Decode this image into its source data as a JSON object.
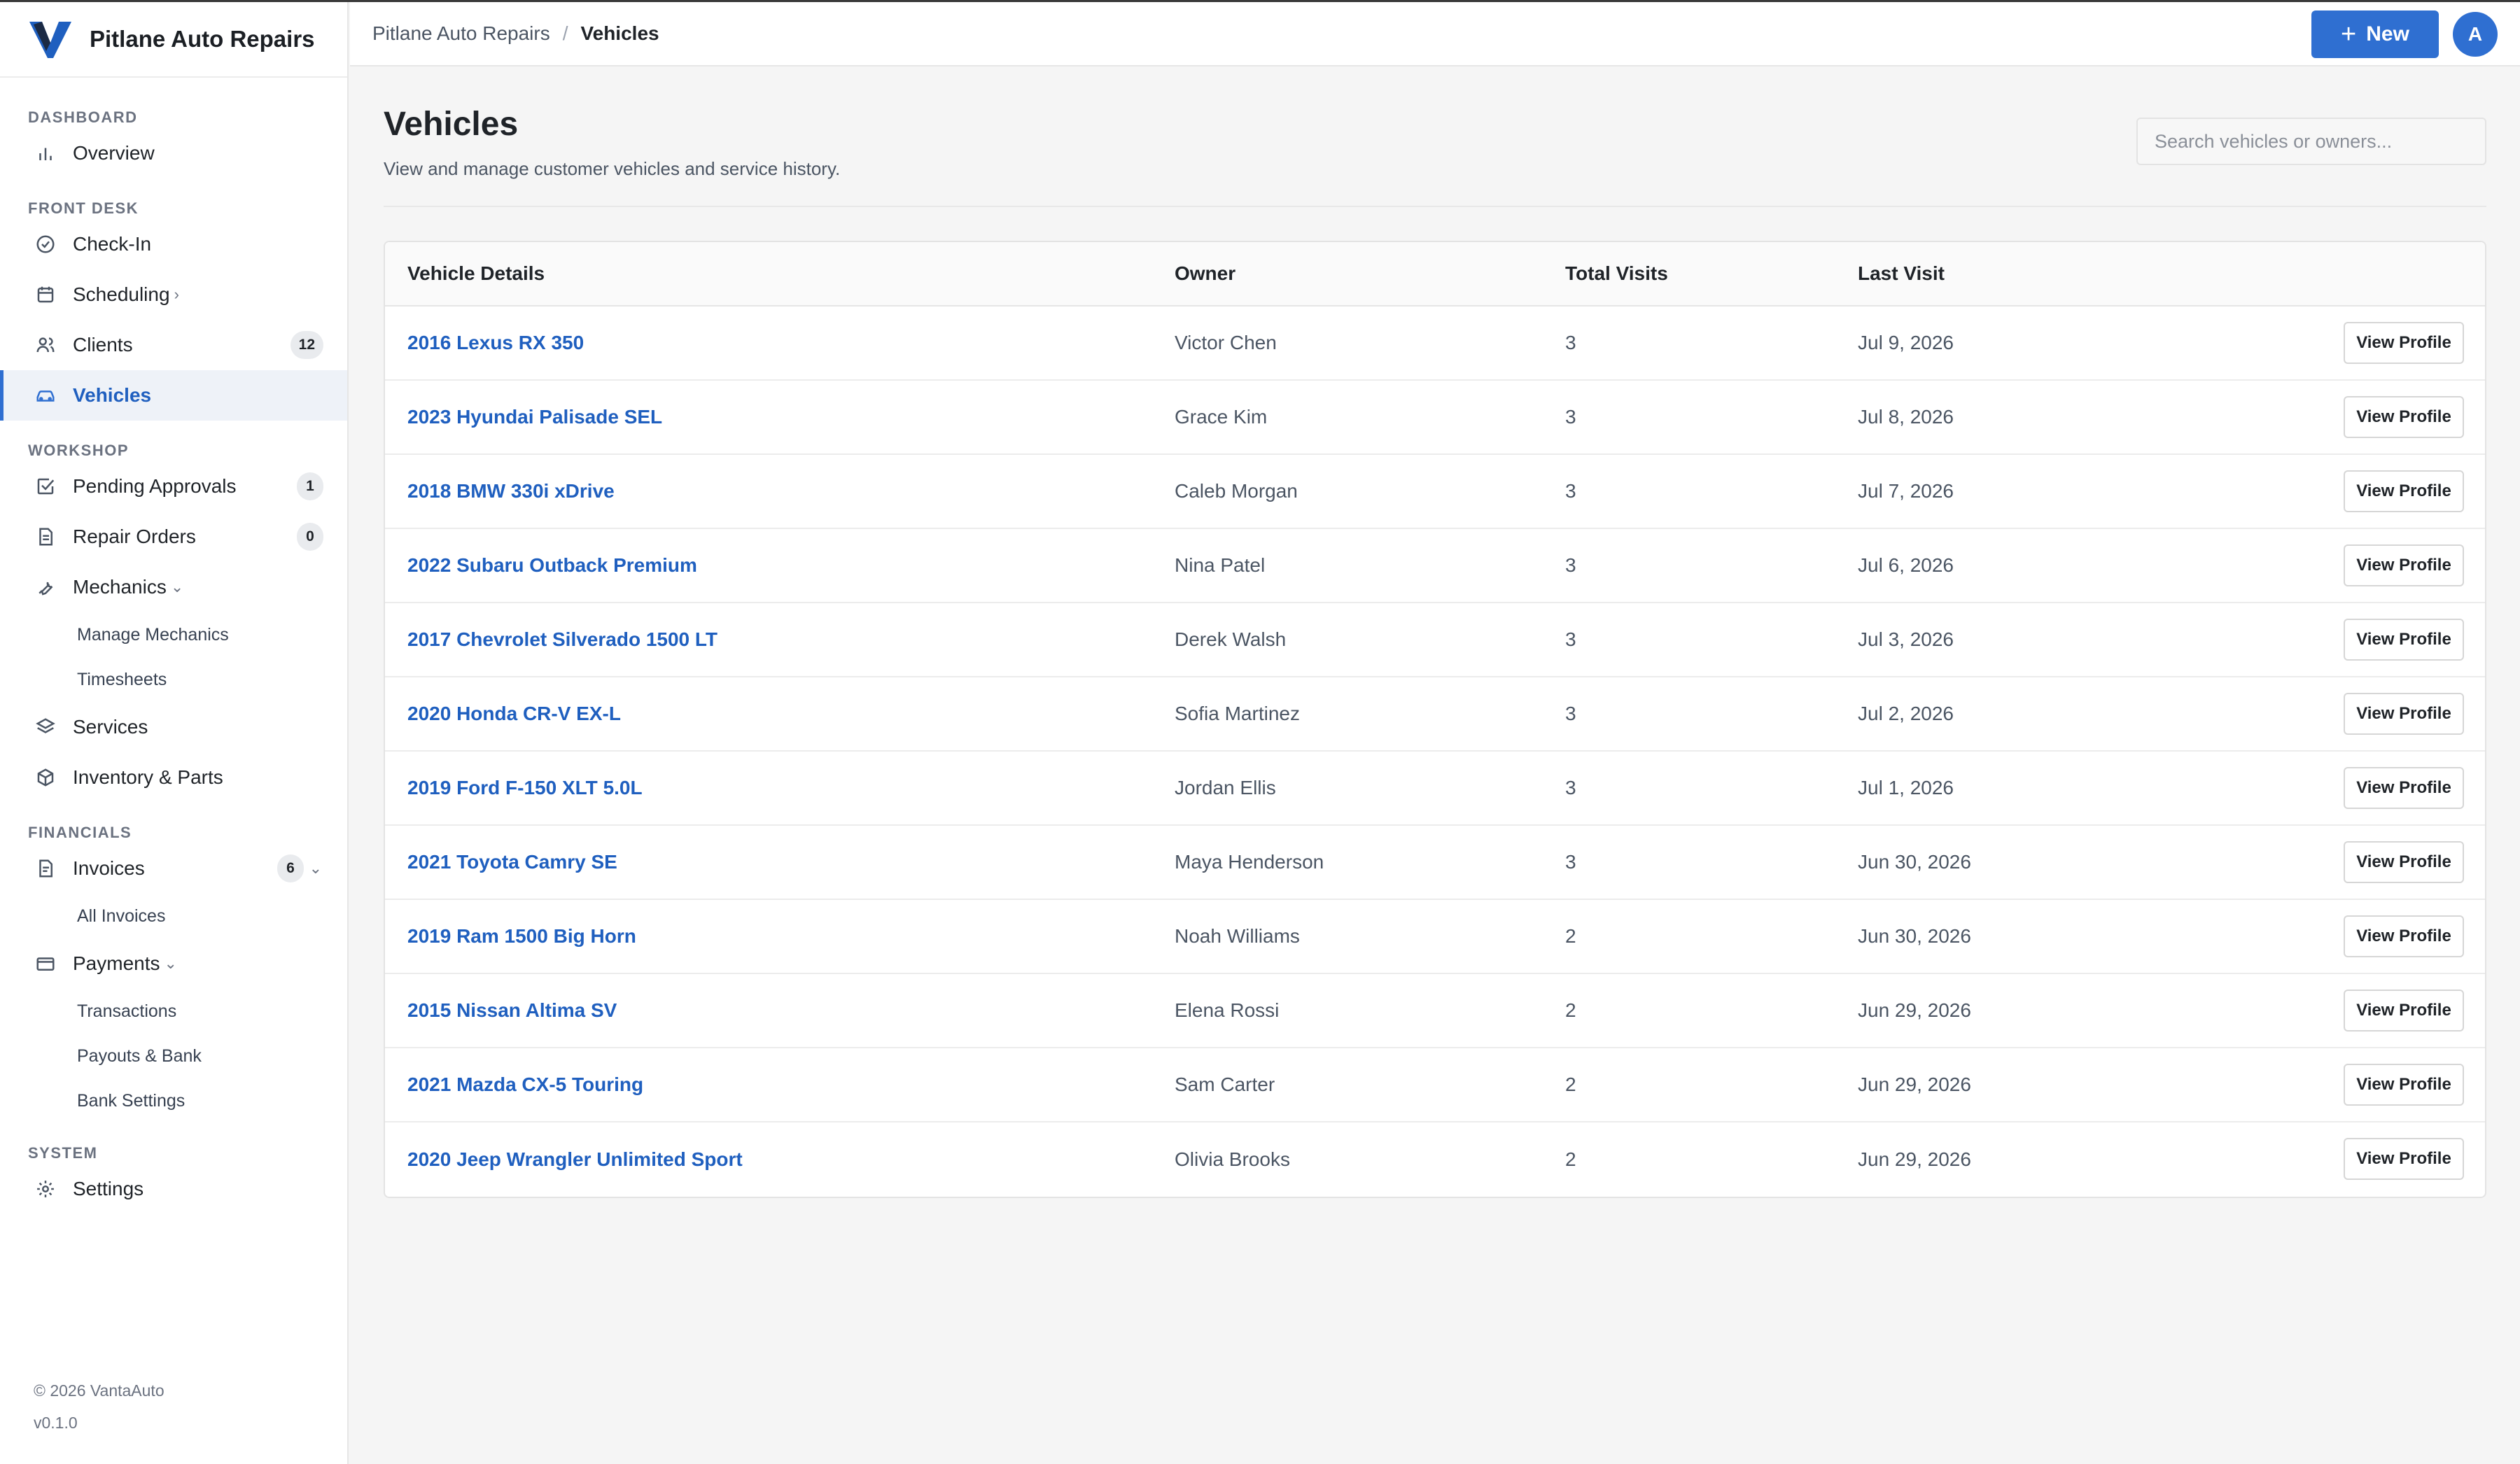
{
  "app": {
    "name": "Pitlane Auto Repairs"
  },
  "sidebar": {
    "sections": {
      "dashboard": {
        "title": "DASHBOARD",
        "overview": "Overview"
      },
      "front_desk": {
        "title": "FRONT DESK",
        "checkin": "Check-In",
        "scheduling": "Scheduling",
        "clients": "Clients",
        "clients_badge": "12",
        "vehicles": "Vehicles"
      },
      "workshop": {
        "title": "WORKSHOP",
        "pending": "Pending Approvals",
        "pending_badge": "1",
        "repair_orders": "Repair Orders",
        "repair_badge": "0",
        "mechanics": "Mechanics",
        "manage_mechanics": "Manage Mechanics",
        "timesheets": "Timesheets",
        "services": "Services",
        "inventory": "Inventory & Parts"
      },
      "financials": {
        "title": "FINANCIALS",
        "invoices": "Invoices",
        "invoices_badge": "6",
        "all_invoices": "All Invoices",
        "payments": "Payments",
        "transactions": "Transactions",
        "payouts": "Payouts & Bank",
        "bank_settings": "Bank Settings"
      },
      "system": {
        "title": "SYSTEM",
        "settings": "Settings"
      }
    },
    "footer": {
      "copyright": "© 2026 VantaAuto",
      "version": "v0.1.0"
    }
  },
  "header": {
    "breadcrumb_root": "Pitlane Auto Repairs",
    "breadcrumb_sep": "/",
    "breadcrumb_current": "Vehicles",
    "new_button_icon": "+",
    "new_button": "New",
    "avatar_initial": "A"
  },
  "main": {
    "title": "Vehicles",
    "subtitle": "View and manage customer vehicles and service history.",
    "search_placeholder": "Search vehicles or owners...",
    "columns": {
      "vehicle": "Vehicle Details",
      "owner": "Owner",
      "visits": "Total Visits",
      "last_visit": "Last Visit"
    },
    "action_label": "View Profile",
    "rows": [
      {
        "vehicle": "2016 Lexus RX 350",
        "owner": "Victor Chen",
        "visits": "3",
        "last_visit": "Jul 9, 2026"
      },
      {
        "vehicle": "2023 Hyundai Palisade SEL",
        "owner": "Grace Kim",
        "visits": "3",
        "last_visit": "Jul 8, 2026"
      },
      {
        "vehicle": "2018 BMW 330i xDrive",
        "owner": "Caleb Morgan",
        "visits": "3",
        "last_visit": "Jul 7, 2026"
      },
      {
        "vehicle": "2022 Subaru Outback Premium",
        "owner": "Nina Patel",
        "visits": "3",
        "last_visit": "Jul 6, 2026"
      },
      {
        "vehicle": "2017 Chevrolet Silverado 1500 LT",
        "owner": "Derek Walsh",
        "visits": "3",
        "last_visit": "Jul 3, 2026"
      },
      {
        "vehicle": "2020 Honda CR-V EX-L",
        "owner": "Sofia Martinez",
        "visits": "3",
        "last_visit": "Jul 2, 2026"
      },
      {
        "vehicle": "2019 Ford F-150 XLT 5.0L",
        "owner": "Jordan Ellis",
        "visits": "3",
        "last_visit": "Jul 1, 2026"
      },
      {
        "vehicle": "2021 Toyota Camry SE",
        "owner": "Maya Henderson",
        "visits": "3",
        "last_visit": "Jun 30, 2026"
      },
      {
        "vehicle": "2019 Ram 1500 Big Horn",
        "owner": "Noah Williams",
        "visits": "2",
        "last_visit": "Jun 30, 2026"
      },
      {
        "vehicle": "2015 Nissan Altima SV",
        "owner": "Elena Rossi",
        "visits": "2",
        "last_visit": "Jun 29, 2026"
      },
      {
        "vehicle": "2021 Mazda CX-5 Touring",
        "owner": "Sam Carter",
        "visits": "2",
        "last_visit": "Jun 29, 2026"
      },
      {
        "vehicle": "2020 Jeep Wrangler Unlimited Sport",
        "owner": "Olivia Brooks",
        "visits": "2",
        "last_visit": "Jun 29, 2026"
      }
    ]
  },
  "colors": {
    "accent": "#2f6fd1",
    "link": "#1f5fbf",
    "background": "#f5f5f5"
  },
  "icons": [
    "bar-chart-icon",
    "check-circle-icon",
    "calendar-icon",
    "users-icon",
    "car-icon",
    "check-square-icon",
    "document-icon",
    "wrench-icon",
    "layers-icon",
    "box-icon",
    "invoice-icon",
    "credit-card-icon",
    "gear-icon",
    "plus-icon"
  ]
}
